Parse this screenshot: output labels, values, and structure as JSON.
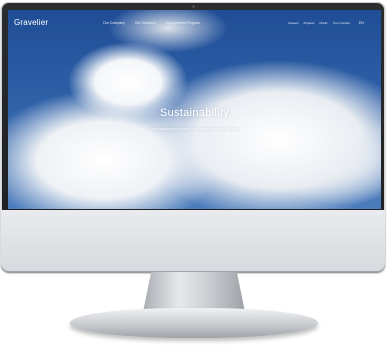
{
  "site": {
    "logo": "Gravelier",
    "nav_center": [
      "Our Company",
      "Our Solutions",
      "Engagement Program"
    ],
    "nav_right": [
      "Careers",
      "Projects",
      "Public",
      "Your Contact"
    ],
    "language": "EN"
  },
  "hero": {
    "title": "Sustainability",
    "subtitle": "to a sustainable future for the engineering industry"
  }
}
